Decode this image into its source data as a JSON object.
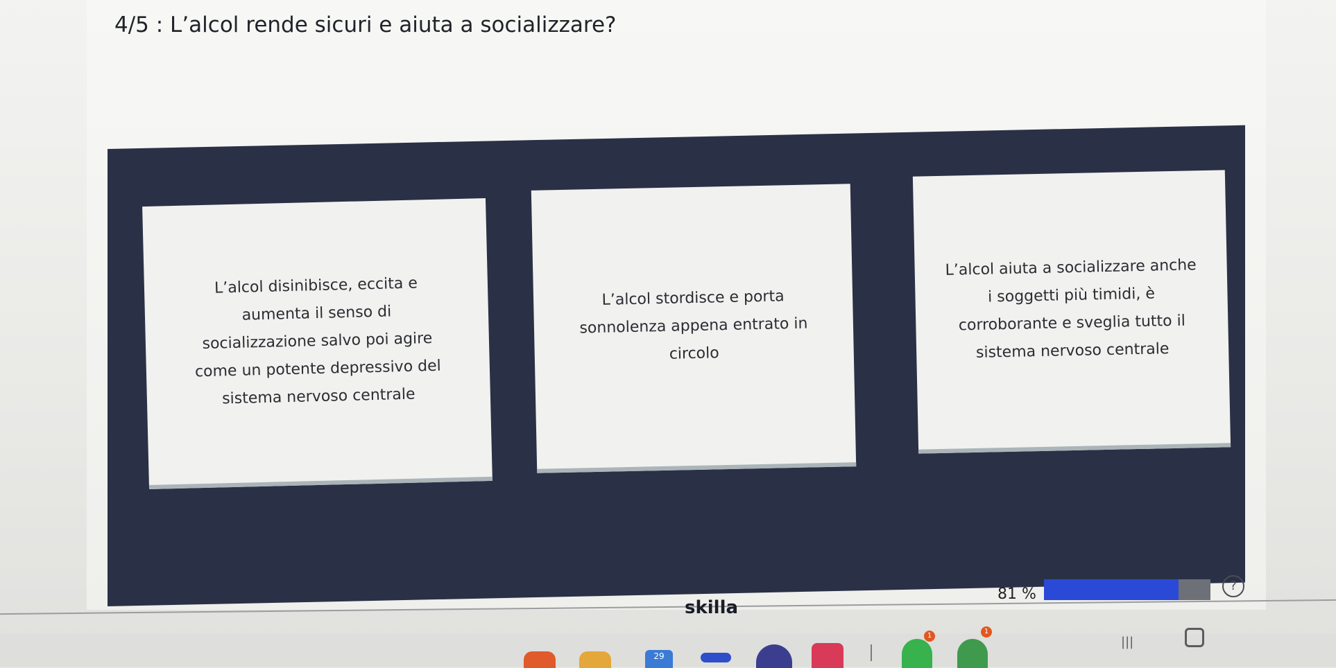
{
  "question": {
    "text": "4/5 : L’alcol rende sicuri e aiuta a socializzare?"
  },
  "options": [
    {
      "text": "L’alcol disinibisce, eccita e\naumenta il senso di\nsocializzazione salvo poi agire\ncome un potente depressivo del\nsistema nervoso centrale"
    },
    {
      "text": "L’alcol stordisce e porta\nsonnolenza appena entrato in\ncircolo"
    },
    {
      "text": "L’alcol aiuta a socializzare anche\ni soggetti più timidi, è\ncorroborante e sveglia tutto il\nsistema nervoso centrale"
    }
  ],
  "footer": {
    "brand": "skilla",
    "progress_label": "81 %",
    "progress_value": 81,
    "help_symbol": "?"
  },
  "taskbar": {
    "calendar_day": "29",
    "badge_1": "1",
    "badge_2": "1",
    "recents_symbol": "|||"
  }
}
